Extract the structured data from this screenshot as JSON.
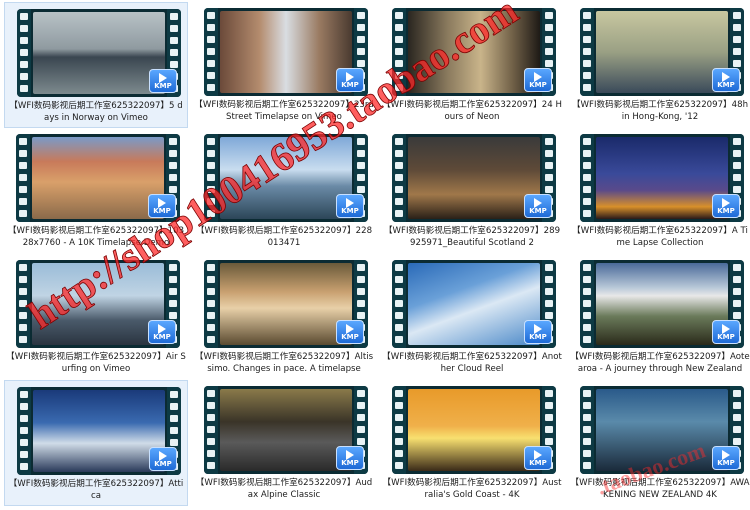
{
  "badge_label": "KMP",
  "colors": {
    "film_strip": "#0d3a44",
    "film_hole": "#e9f3f5",
    "badge": "#1e6ad6",
    "watermark": "#ff2a2a",
    "selected_bg": "#e8f1fb"
  },
  "watermarks": {
    "main": "http://shop100416953.taobao.com",
    "secondary": ".taobao.com"
  },
  "items": [
    {
      "caption": "【WFI数码影视后期工作室625322097】5 days in Norway on Vimeo",
      "bg": "linear-gradient(#b8c2c6 0%,#8f9aa0 45%,#3a4650 55%,#7d8a8e 100%)",
      "selected": true
    },
    {
      "caption": "【WFI数码影视后期工作室625322097】23rd Street Timelapse on Vimeo",
      "bg": "linear-gradient(90deg,#6b4a3a 0%,#b48c6e 30%,#d9dde2 50%,#9a7b62 75%,#4a3a30 100%)",
      "selected": false
    },
    {
      "caption": "【WFI数码影视后期工作室625322097】24 Hours of Neon",
      "bg": "linear-gradient(90deg,#2a2620 0%,#8a7a5e 30%,#c9b48a 55%,#6e5e46 80%,#1e1a16 100%)",
      "selected": false
    },
    {
      "caption": "【WFI数码影视后期工作室625322097】48h in Hong-Kong, '12",
      "bg": "linear-gradient(#c8c7a0 0%,#9aa084 50%,#3a4a5a 100%)",
      "selected": false
    },
    {
      "caption": "【WFI数码影视后期工作室625322097】10328x7760 - A 10K Timelapse Demo",
      "bg": "linear-gradient(#7a9ac8 0%,#c87a5a 30%,#d9a06a 55%,#8a6a4a 100%)",
      "selected": false
    },
    {
      "caption": "【WFI数码影视后期工作室625322097】228013471",
      "bg": "linear-gradient(#7fa8d8 0%,#c9ddef 40%,#6a8aa6 60%,#2c4658 100%)",
      "selected": false
    },
    {
      "caption": "【WFI数码影视后期工作室625322097】289925971_Beautiful Scotland 2",
      "bg": "linear-gradient(#3a3a3a 0%,#5e4a38 40%,#a0784a 70%,#2a2018 100%)",
      "selected": false
    },
    {
      "caption": "【WFI数码影视后期工作室625322097】A Time Lapse Collection",
      "bg": "linear-gradient(#1a2a6a 0%,#3a4a9a 45%,#5a4a8a 65%,#d8902a 85%,#2a1a1a 100%)",
      "selected": false
    },
    {
      "caption": "【WFI数码影视后期工作室625322097】Air Surfing on Vimeo",
      "bg": "linear-gradient(#9abcd8 0%,#c0d4e4 40%,#4a5a6a 70%,#2a3440 100%)",
      "selected": false
    },
    {
      "caption": "【WFI数码影视后期工作室625322097】Altissimo. Changes in pace. A timelapse",
      "bg": "linear-gradient(#6a5a3a 0%,#c8a070 35%,#e8d0a8 55%,#5a4a30 100%)",
      "selected": false
    },
    {
      "caption": "【WFI数码影视后期工作室625322097】Another Cloud Reel",
      "bg": "linear-gradient(160deg,#2a6ab8 0%,#6aa0d8 35%,#dbe8f4 55%,#4a88c8 100%)",
      "selected": false
    },
    {
      "caption": "【WFI数码影视后期工作室625322097】Aotearoa - A journey through New Zealand",
      "bg": "linear-gradient(#4a6a9a 0%,#b8c8d8 30%,#e8e8e8 40%,#6a7a5a 65%,#2a2a1a 100%)",
      "selected": false
    },
    {
      "caption": "【WFI数码影视后期工作室625322097】Attica",
      "bg": "linear-gradient(#1a3a7a 0%,#3a6ab0 40%,#d0dce8 65%,#2a3a5a 100%)",
      "selected": true
    },
    {
      "caption": "【WFI数码影视后期工作室625322097】Audax Alpine Classic",
      "bg": "linear-gradient(#8a7a4a 0%,#3a3428 40%,#5a5a5a 65%,#2a2a2a 100%)",
      "selected": false
    },
    {
      "caption": "【WFI数码影视后期工作室625322097】Australia's Gold Coast - 4K",
      "bg": "linear-gradient(#e89a2a 0%,#f0b04a 45%,#f8e070 60%,#3a2a18 100%)",
      "selected": false
    },
    {
      "caption": "【WFI数码影视后期工作室625322097】AWAKENING  NEW ZEALAND 4K",
      "bg": "linear-gradient(#2a5a8a 0%,#5a8aaa 40%,#1a2a3a 100%)",
      "selected": false
    }
  ]
}
